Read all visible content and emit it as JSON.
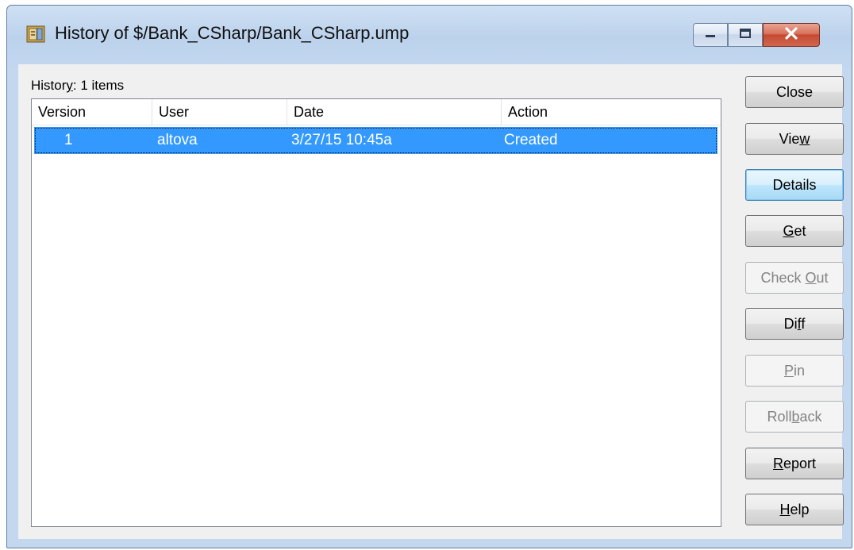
{
  "window": {
    "title": "History of $/Bank_CSharp/Bank_CSharp.ump"
  },
  "caption_buttons": {
    "minimize_icon": "minimize-icon",
    "maximize_icon": "maximize-icon",
    "close_icon": "close-x-icon"
  },
  "history": {
    "label_prefix": "Histor",
    "label_accel": "y",
    "label_suffix": ": 1 items",
    "columns": [
      "Version",
      "User",
      "Date",
      "Action"
    ],
    "rows": [
      {
        "version": "1",
        "user": "altova",
        "date": "3/27/15 10:45a",
        "action": "Created",
        "selected": true
      }
    ]
  },
  "buttons": [
    {
      "id": "close",
      "pre": "Close",
      "acc": "",
      "post": "",
      "state": "normal"
    },
    {
      "id": "view",
      "pre": "Vie",
      "acc": "w",
      "post": "",
      "state": "normal"
    },
    {
      "id": "details",
      "pre": "Details",
      "acc": "",
      "post": "",
      "state": "default"
    },
    {
      "id": "get",
      "pre": "",
      "acc": "G",
      "post": "et",
      "state": "normal"
    },
    {
      "id": "check-out",
      "pre": "Check ",
      "acc": "O",
      "post": "ut",
      "state": "disabled"
    },
    {
      "id": "diff",
      "pre": "Di",
      "acc": "f",
      "post": "f",
      "state": "normal"
    },
    {
      "id": "pin",
      "pre": "",
      "acc": "P",
      "post": "in",
      "state": "disabled"
    },
    {
      "id": "rollback",
      "pre": "Roll",
      "acc": "b",
      "post": "ack",
      "state": "disabled"
    },
    {
      "id": "report",
      "pre": "",
      "acc": "R",
      "post": "eport",
      "state": "normal"
    },
    {
      "id": "help",
      "pre": "",
      "acc": "H",
      "post": "elp",
      "state": "normal"
    }
  ],
  "colors": {
    "selection": "#3399ff",
    "close_caption": "#c44a32"
  }
}
